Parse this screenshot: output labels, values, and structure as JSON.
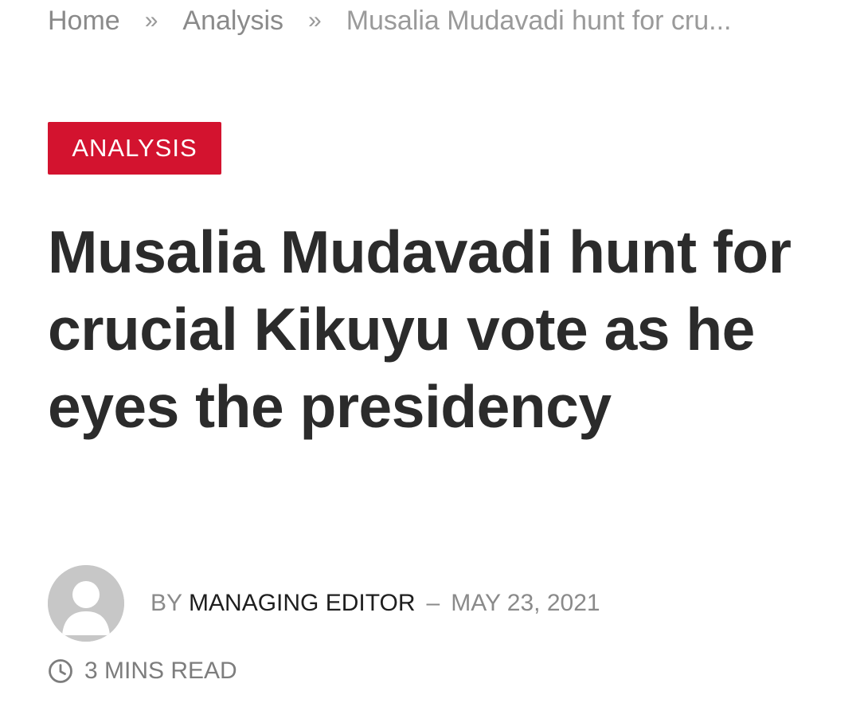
{
  "breadcrumb": {
    "home": "Home",
    "separator": "»",
    "section": "Analysis",
    "current": "Musalia Mudavadi hunt for cru..."
  },
  "category": {
    "label": "ANALYSIS",
    "color": "#d3132f"
  },
  "article": {
    "title": "Musalia Mudavadi hunt for crucial Kikuyu vote as he eyes the presidency"
  },
  "meta": {
    "avatar_icon": "default-user-avatar-icon",
    "by_label": "BY",
    "author": "MANAGING EDITOR",
    "separator": "–",
    "date": "MAY 23, 2021",
    "read_time_icon": "clock-icon",
    "read_time": "3 MINS READ"
  }
}
